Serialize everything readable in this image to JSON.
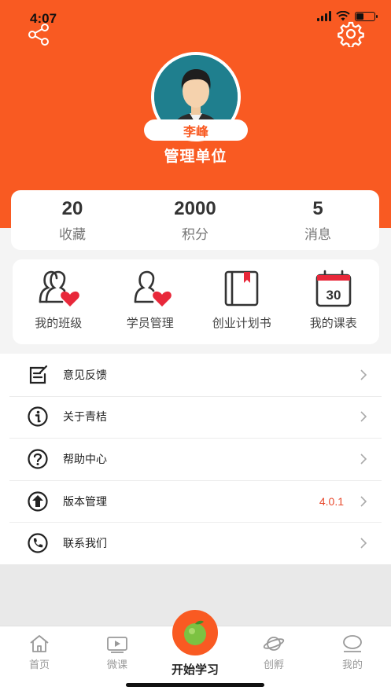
{
  "status_bar": {
    "time": "4:07"
  },
  "profile": {
    "name": "李峰",
    "unit": "管理单位"
  },
  "stats": [
    {
      "value": "20",
      "label": "收藏"
    },
    {
      "value": "2000",
      "label": "积分"
    },
    {
      "value": "5",
      "label": "消息"
    }
  ],
  "features": [
    {
      "label": "我的班级",
      "icon": "class-icon"
    },
    {
      "label": "学员管理",
      "icon": "student-management-icon"
    },
    {
      "label": "创业计划书",
      "icon": "business-plan-icon"
    },
    {
      "label": "我的课表",
      "icon": "calendar-icon",
      "icon_text": "30"
    }
  ],
  "menu": [
    {
      "label": "意见反馈",
      "icon": "feedback-icon",
      "value": ""
    },
    {
      "label": "关于青桔",
      "icon": "info-icon",
      "value": ""
    },
    {
      "label": "帮助中心",
      "icon": "help-icon",
      "value": ""
    },
    {
      "label": "版本管理",
      "icon": "upload-icon",
      "value": "4.0.1"
    },
    {
      "label": "联系我们",
      "icon": "phone-icon",
      "value": ""
    }
  ],
  "tabbar": {
    "items": [
      {
        "label": "首页",
        "icon": "home-icon"
      },
      {
        "label": "微课",
        "icon": "video-icon"
      },
      {
        "label": "开始学习",
        "icon": "orange-fruit-icon"
      },
      {
        "label": "创孵",
        "icon": "planet-icon"
      },
      {
        "label": "我的",
        "icon": "profile-icon"
      }
    ]
  },
  "colors": {
    "accent": "#f95a22",
    "version_text": "#e8482c",
    "heart": "#e8283a"
  }
}
